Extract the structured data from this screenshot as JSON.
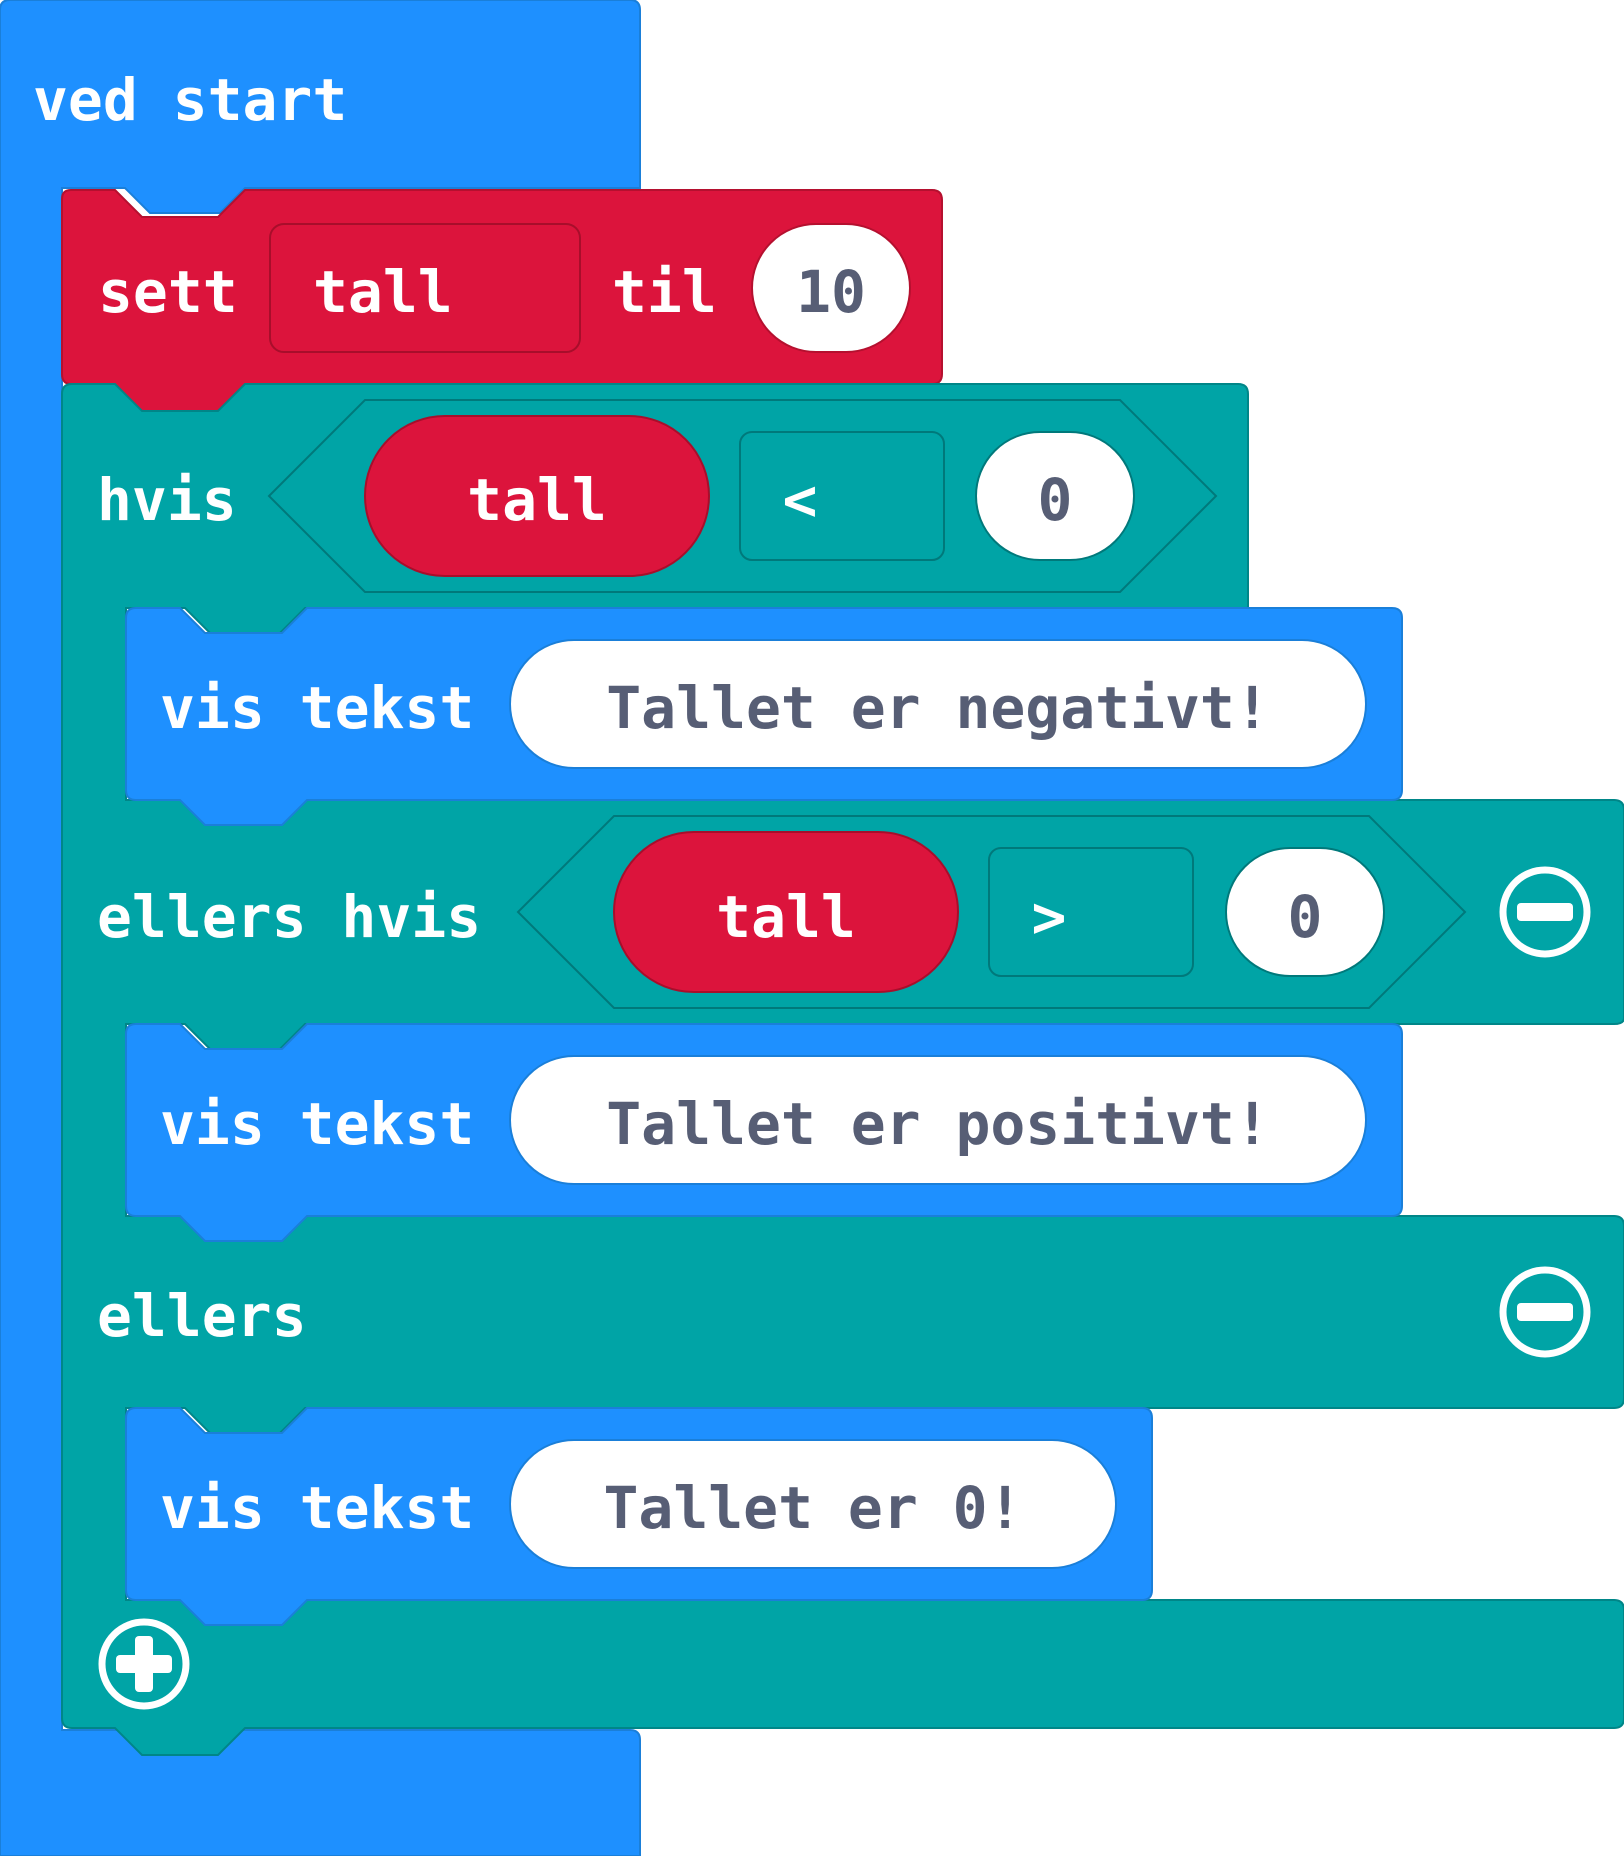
{
  "blocks": {
    "on_start": {
      "label": "ved start",
      "color": "#1e90ff"
    },
    "set_var": {
      "keyword": "sett",
      "variable": "tall",
      "to_label": "til",
      "value": "10",
      "color": "#dc143c"
    },
    "if_block": {
      "color": "#00a4a6",
      "if_label": "hvis",
      "condition1": {
        "left": "tall",
        "operator": "<",
        "right": "0"
      },
      "then1": {
        "label": "vis tekst",
        "text": "Tallet er negativt!"
      },
      "elseif_label": "ellers hvis",
      "condition2": {
        "left": "tall",
        "operator": ">",
        "right": "0"
      },
      "then2": {
        "label": "vis tekst",
        "text": "Tallet er positivt!"
      },
      "else_label": "ellers",
      "then3": {
        "label": "vis tekst",
        "text": "Tallet er 0!"
      }
    }
  },
  "icons": {
    "remove_elseif": "minus-circle-icon",
    "remove_else": "minus-circle-icon",
    "add_branch": "plus-circle-icon"
  },
  "colors": {
    "event_blue": "#1e90ff",
    "variable_red": "#dc143c",
    "logic_teal": "#00a4a6",
    "text_gray": "#575e75"
  }
}
